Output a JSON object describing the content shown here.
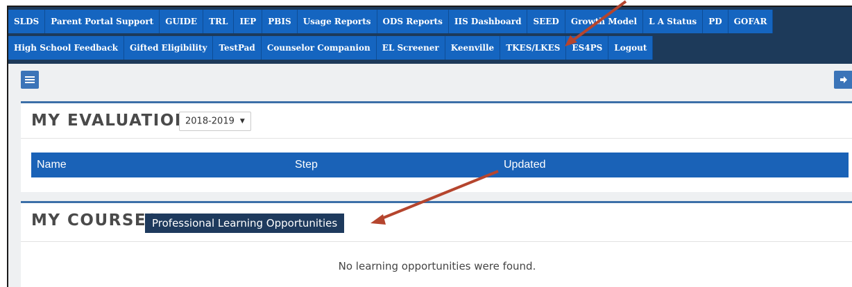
{
  "nav": {
    "row1": [
      "SLDS",
      "Parent Portal Support",
      "GUIDE",
      "TRL",
      "IEP",
      "PBIS",
      "Usage Reports",
      "ODS Reports",
      "IIS Dashboard",
      "SEED",
      "Growth Model",
      "L A Status",
      "PD",
      "GOFAR"
    ],
    "row2": [
      "High School Feedback",
      "Gifted Eligibility",
      "TestPad",
      "Counselor Companion",
      "EL Screener",
      "Keenville",
      "TKES/LKES",
      "ES4PS",
      "Logout"
    ]
  },
  "toolbar": {
    "menu_icon": "hamburger-menu-icon",
    "exit_icon": "sign-out-icon"
  },
  "evaluation": {
    "title": "MY EVALUATION",
    "year": "2018-2019",
    "columns": [
      "Name",
      "Step",
      "Updated"
    ]
  },
  "courses": {
    "title": "MY COURSES",
    "button": "Professional Learning Opportunities",
    "empty_message": "No learning opportunities were found."
  },
  "colors": {
    "nav_bg": "#1d3a5a",
    "nav_item": "#1565c0",
    "header_blue": "#1a62b7",
    "arrow": "#b5452e"
  }
}
